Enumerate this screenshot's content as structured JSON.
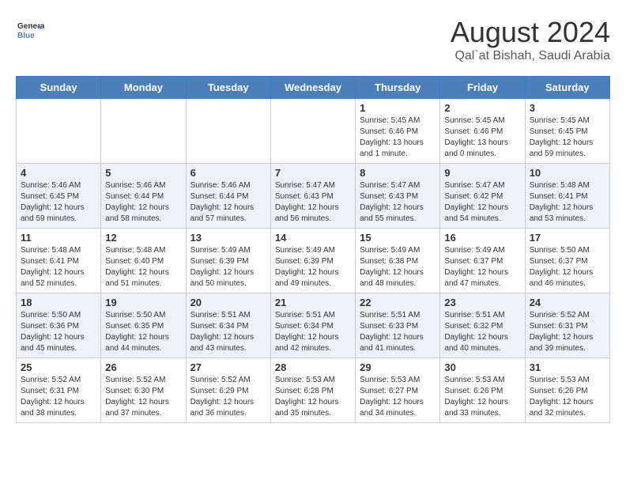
{
  "header": {
    "logo_line1": "General",
    "logo_line2": "Blue",
    "month": "August 2024",
    "location": "Qal`at Bishah, Saudi Arabia"
  },
  "weekdays": [
    "Sunday",
    "Monday",
    "Tuesday",
    "Wednesday",
    "Thursday",
    "Friday",
    "Saturday"
  ],
  "weeks": [
    [
      {
        "day": "",
        "info": ""
      },
      {
        "day": "",
        "info": ""
      },
      {
        "day": "",
        "info": ""
      },
      {
        "day": "",
        "info": ""
      },
      {
        "day": "1",
        "info": "Sunrise: 5:45 AM\nSunset: 6:46 PM\nDaylight: 13 hours\nand 1 minute."
      },
      {
        "day": "2",
        "info": "Sunrise: 5:45 AM\nSunset: 6:46 PM\nDaylight: 13 hours\nand 0 minutes."
      },
      {
        "day": "3",
        "info": "Sunrise: 5:45 AM\nSunset: 6:45 PM\nDaylight: 12 hours\nand 59 minutes."
      }
    ],
    [
      {
        "day": "4",
        "info": "Sunrise: 5:46 AM\nSunset: 6:45 PM\nDaylight: 12 hours\nand 59 minutes."
      },
      {
        "day": "5",
        "info": "Sunrise: 5:46 AM\nSunset: 6:44 PM\nDaylight: 12 hours\nand 58 minutes."
      },
      {
        "day": "6",
        "info": "Sunrise: 5:46 AM\nSunset: 6:44 PM\nDaylight: 12 hours\nand 57 minutes."
      },
      {
        "day": "7",
        "info": "Sunrise: 5:47 AM\nSunset: 6:43 PM\nDaylight: 12 hours\nand 56 minutes."
      },
      {
        "day": "8",
        "info": "Sunrise: 5:47 AM\nSunset: 6:43 PM\nDaylight: 12 hours\nand 55 minutes."
      },
      {
        "day": "9",
        "info": "Sunrise: 5:47 AM\nSunset: 6:42 PM\nDaylight: 12 hours\nand 54 minutes."
      },
      {
        "day": "10",
        "info": "Sunrise: 5:48 AM\nSunset: 6:41 PM\nDaylight: 12 hours\nand 53 minutes."
      }
    ],
    [
      {
        "day": "11",
        "info": "Sunrise: 5:48 AM\nSunset: 6:41 PM\nDaylight: 12 hours\nand 52 minutes."
      },
      {
        "day": "12",
        "info": "Sunrise: 5:48 AM\nSunset: 6:40 PM\nDaylight: 12 hours\nand 51 minutes."
      },
      {
        "day": "13",
        "info": "Sunrise: 5:49 AM\nSunset: 6:39 PM\nDaylight: 12 hours\nand 50 minutes."
      },
      {
        "day": "14",
        "info": "Sunrise: 5:49 AM\nSunset: 6:39 PM\nDaylight: 12 hours\nand 49 minutes."
      },
      {
        "day": "15",
        "info": "Sunrise: 5:49 AM\nSunset: 6:38 PM\nDaylight: 12 hours\nand 48 minutes."
      },
      {
        "day": "16",
        "info": "Sunrise: 5:49 AM\nSunset: 6:37 PM\nDaylight: 12 hours\nand 47 minutes."
      },
      {
        "day": "17",
        "info": "Sunrise: 5:50 AM\nSunset: 6:37 PM\nDaylight: 12 hours\nand 46 minutes."
      }
    ],
    [
      {
        "day": "18",
        "info": "Sunrise: 5:50 AM\nSunset: 6:36 PM\nDaylight: 12 hours\nand 45 minutes."
      },
      {
        "day": "19",
        "info": "Sunrise: 5:50 AM\nSunset: 6:35 PM\nDaylight: 12 hours\nand 44 minutes."
      },
      {
        "day": "20",
        "info": "Sunrise: 5:51 AM\nSunset: 6:34 PM\nDaylight: 12 hours\nand 43 minutes."
      },
      {
        "day": "21",
        "info": "Sunrise: 5:51 AM\nSunset: 6:34 PM\nDaylight: 12 hours\nand 42 minutes."
      },
      {
        "day": "22",
        "info": "Sunrise: 5:51 AM\nSunset: 6:33 PM\nDaylight: 12 hours\nand 41 minutes."
      },
      {
        "day": "23",
        "info": "Sunrise: 5:51 AM\nSunset: 6:32 PM\nDaylight: 12 hours\nand 40 minutes."
      },
      {
        "day": "24",
        "info": "Sunrise: 5:52 AM\nSunset: 6:31 PM\nDaylight: 12 hours\nand 39 minutes."
      }
    ],
    [
      {
        "day": "25",
        "info": "Sunrise: 5:52 AM\nSunset: 6:31 PM\nDaylight: 12 hours\nand 38 minutes."
      },
      {
        "day": "26",
        "info": "Sunrise: 5:52 AM\nSunset: 6:30 PM\nDaylight: 12 hours\nand 37 minutes."
      },
      {
        "day": "27",
        "info": "Sunrise: 5:52 AM\nSunset: 6:29 PM\nDaylight: 12 hours\nand 36 minutes."
      },
      {
        "day": "28",
        "info": "Sunrise: 5:53 AM\nSunset: 6:28 PM\nDaylight: 12 hours\nand 35 minutes."
      },
      {
        "day": "29",
        "info": "Sunrise: 5:53 AM\nSunset: 6:27 PM\nDaylight: 12 hours\nand 34 minutes."
      },
      {
        "day": "30",
        "info": "Sunrise: 5:53 AM\nSunset: 6:26 PM\nDaylight: 12 hours\nand 33 minutes."
      },
      {
        "day": "31",
        "info": "Sunrise: 5:53 AM\nSunset: 6:26 PM\nDaylight: 12 hours\nand 32 minutes."
      }
    ]
  ]
}
